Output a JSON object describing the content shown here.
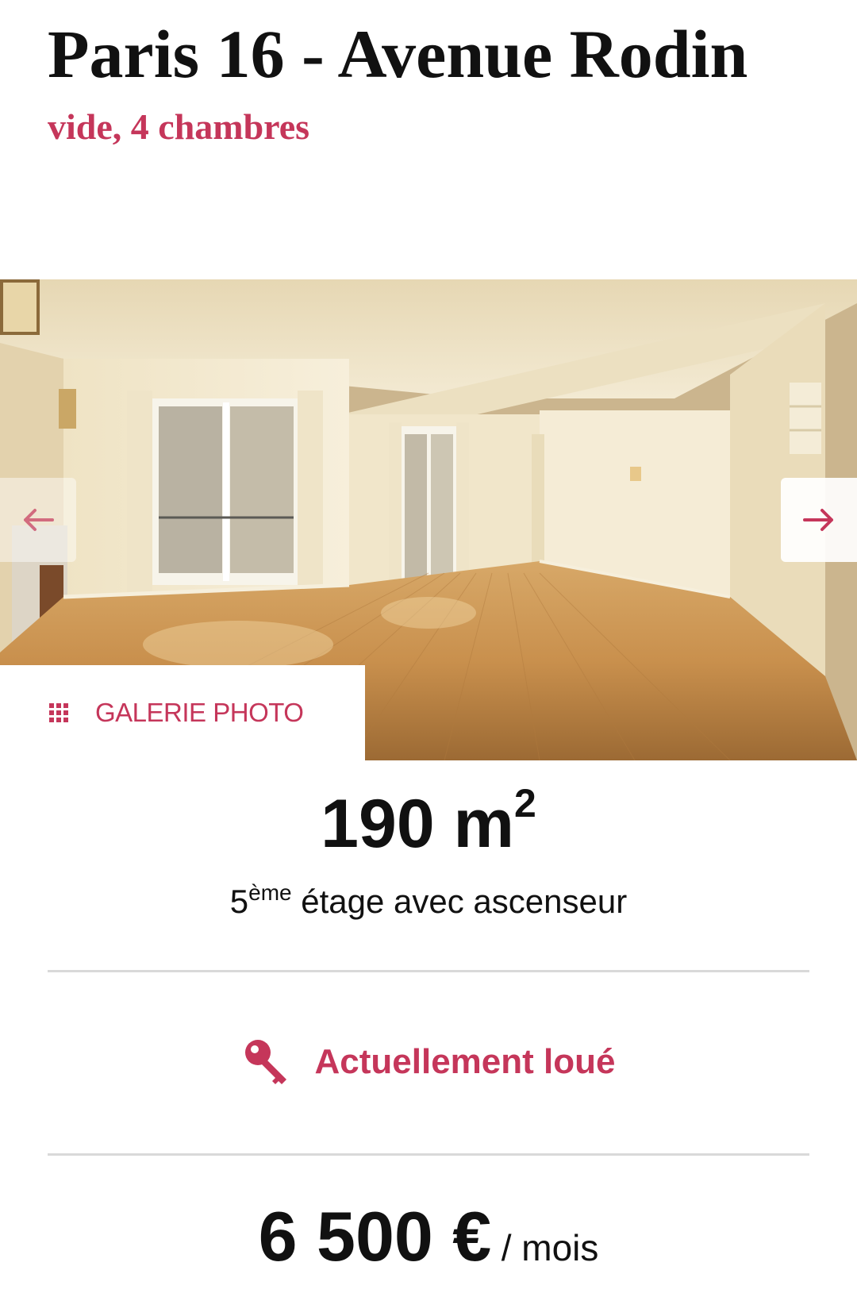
{
  "listing": {
    "title": "Paris 16 - Avenue Rodin",
    "subtitle": "vide, 4 chambres"
  },
  "gallery": {
    "button_label": "GALERIE PHOTO",
    "button_icon": "grid-icon",
    "prev_icon": "arrow-left-icon",
    "next_icon": "arrow-right-icon"
  },
  "specs": {
    "area_value": "190 m",
    "area_exponent": "2",
    "floor_number": "5",
    "floor_suffix": "ème",
    "floor_text": " étage avec ascenseur"
  },
  "status": {
    "label": "Actuellement loué",
    "icon": "key-icon"
  },
  "price": {
    "amount": "6 500 €",
    "unit": "/ mois"
  },
  "colors": {
    "accent": "#c5365a",
    "text": "#111111",
    "divider": "#d9d9d9"
  }
}
